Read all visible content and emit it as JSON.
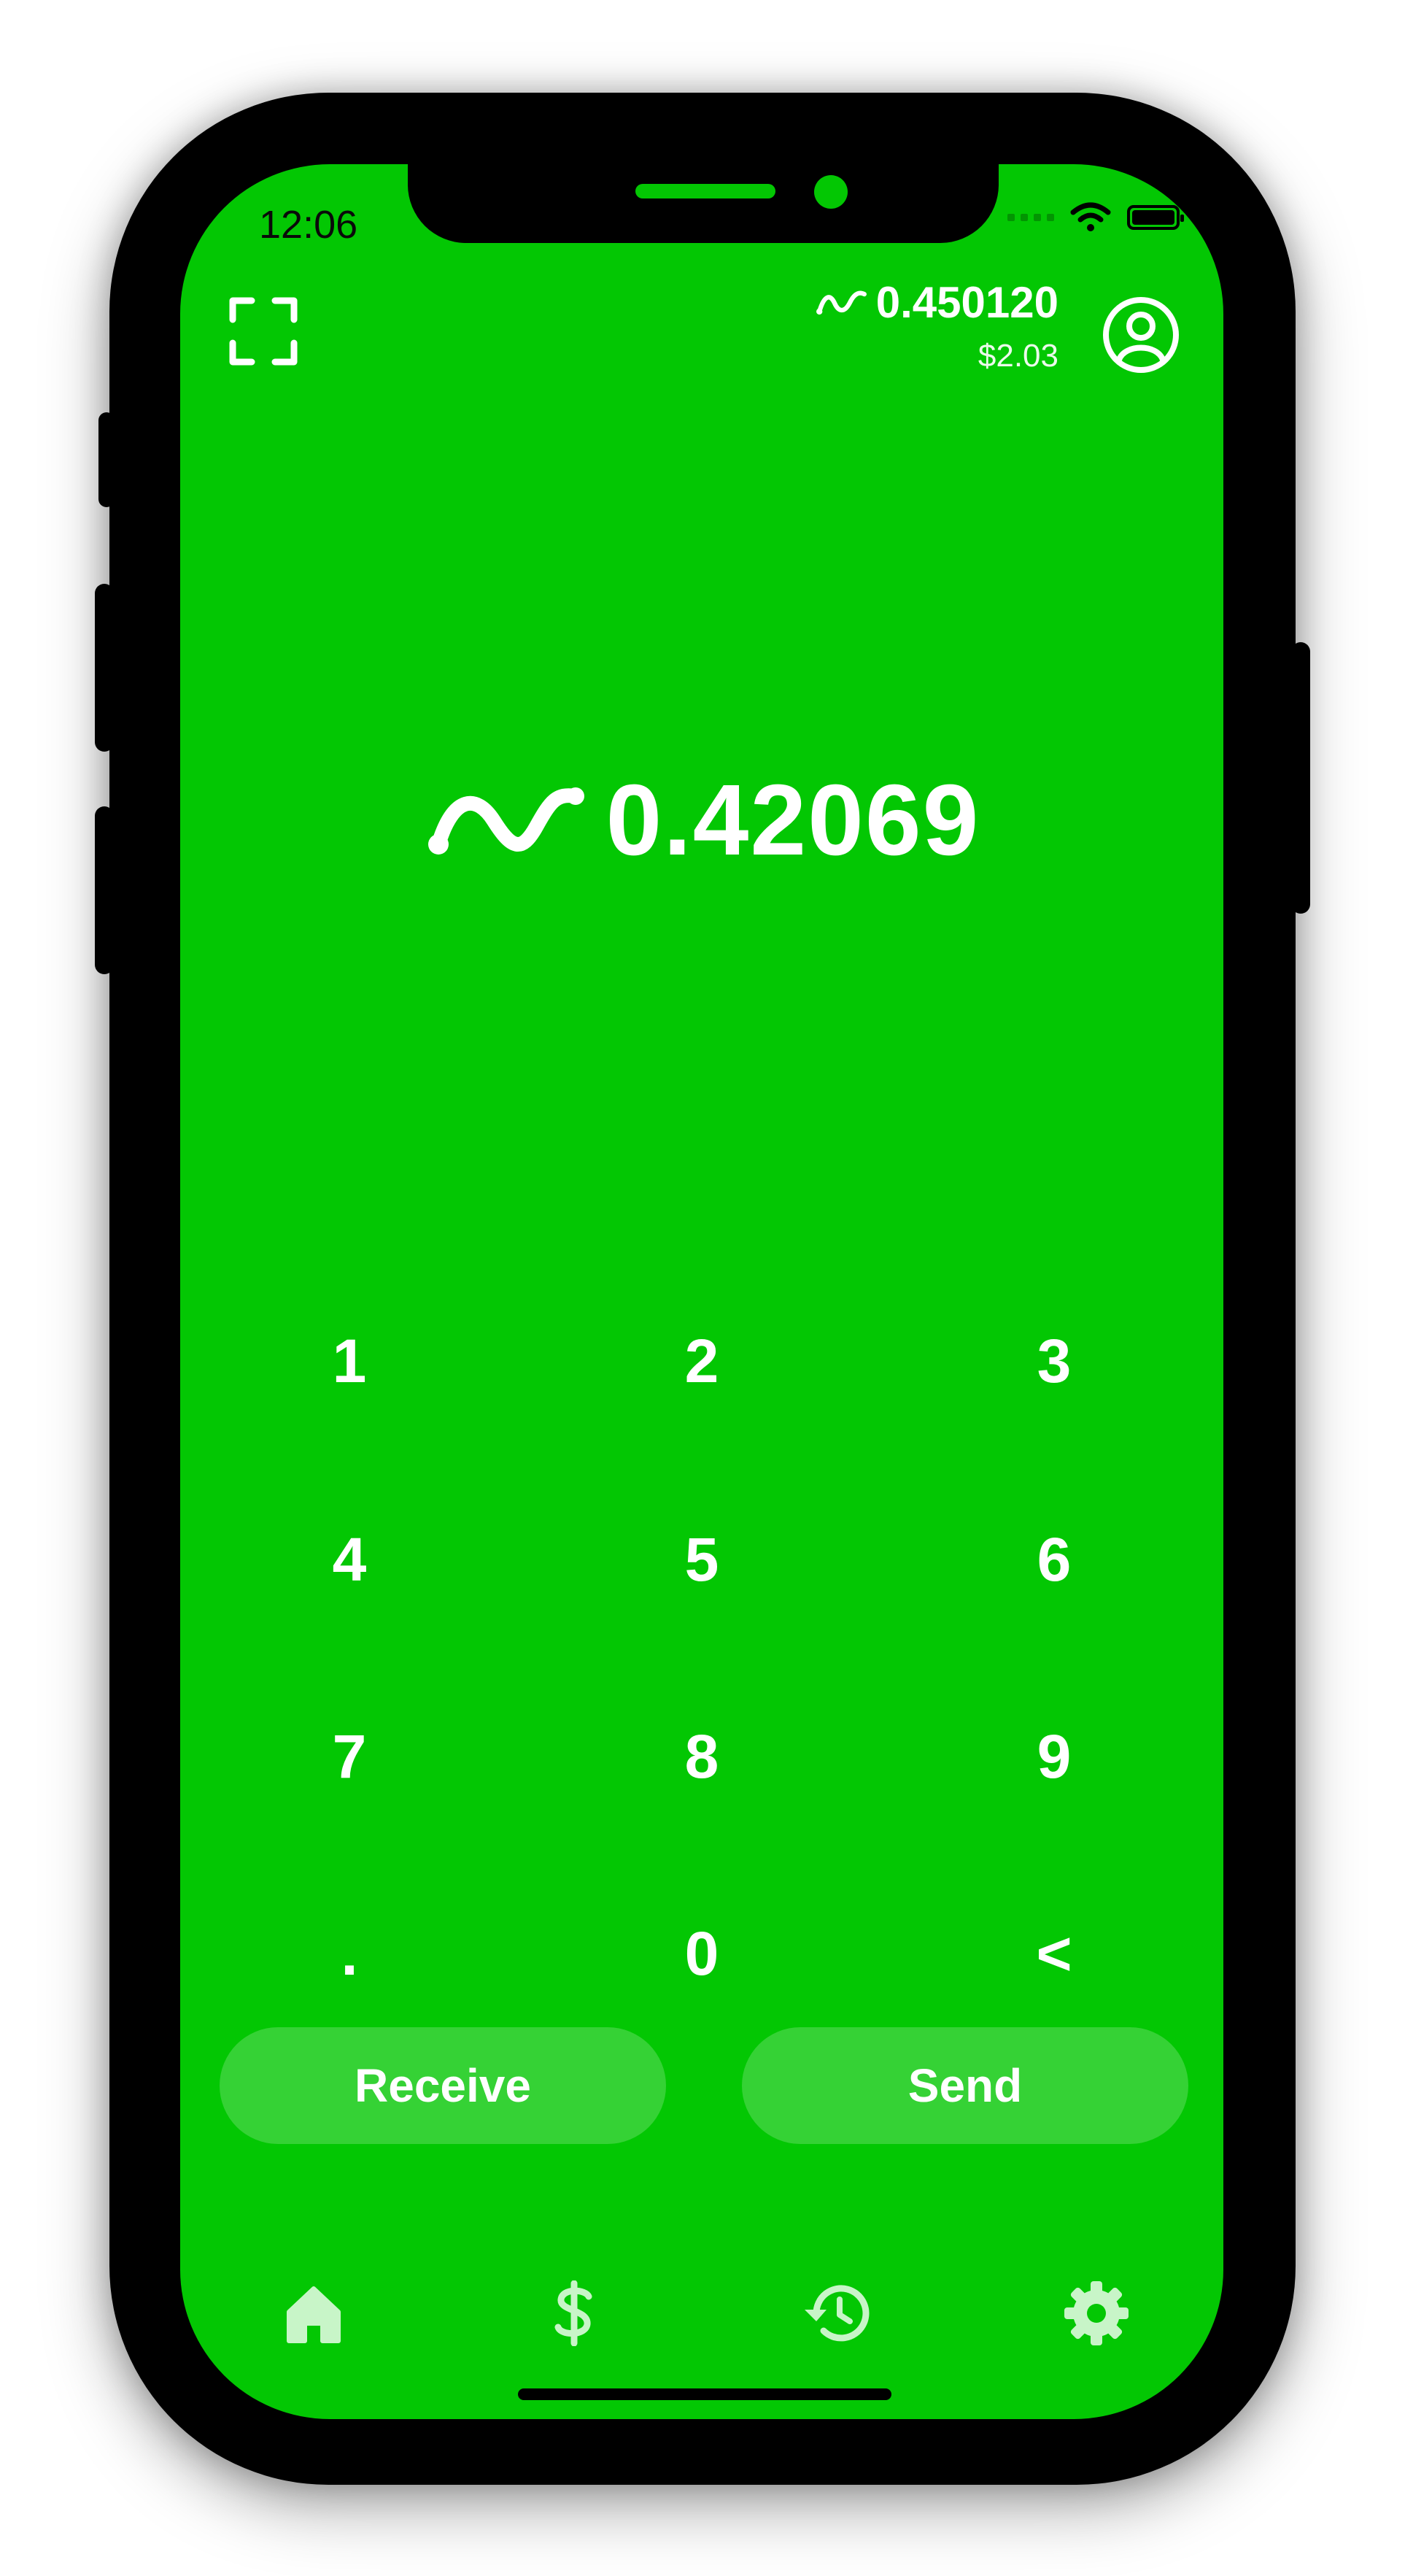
{
  "status_bar": {
    "time": "12:06"
  },
  "header": {
    "balance_nano": "0.450120",
    "balance_fiat": "$2.03",
    "scan_icon": "scan-frame-icon",
    "profile_icon": "user-circle-icon"
  },
  "amount": {
    "value": "0.42069",
    "currency_icon": "nano-icon"
  },
  "keypad": {
    "keys": [
      "1",
      "2",
      "3",
      "4",
      "5",
      "6",
      "7",
      "8",
      "9",
      ".",
      "0",
      "<"
    ]
  },
  "actions": {
    "receive_label": "Receive",
    "send_label": "Send"
  },
  "tabbar": {
    "tabs": [
      {
        "name": "home",
        "icon": "home-icon"
      },
      {
        "name": "dollar",
        "icon": "dollar-icon"
      },
      {
        "name": "history",
        "icon": "history-icon"
      },
      {
        "name": "settings",
        "icon": "gear-icon"
      }
    ]
  },
  "colors": {
    "accent": "#03c703",
    "button_fill": "rgba(255,255,255,0.2)",
    "tab_icon": "#c8f5c8"
  }
}
